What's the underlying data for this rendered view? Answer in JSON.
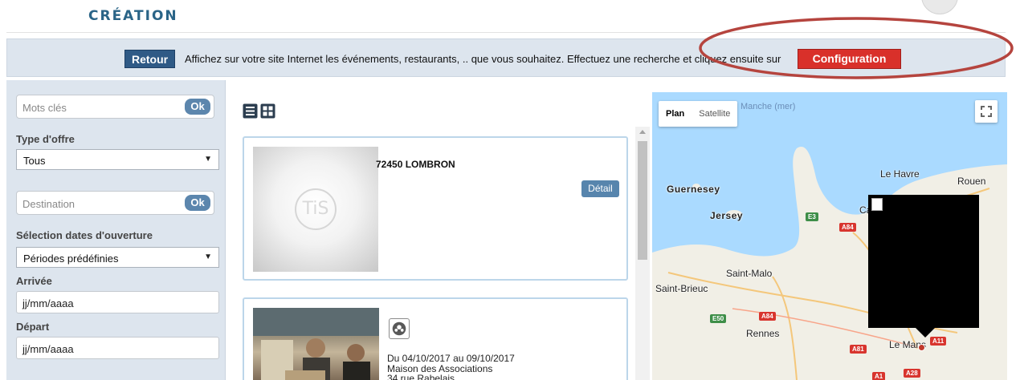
{
  "header": {
    "title": "CRÉATION"
  },
  "infobar": {
    "back_label": "Retour",
    "message": "Affichez sur votre site Internet les événements, restaurants, .. que vous souhaitez. Effectuez une recherche et cliquez ensuite sur",
    "config_label": "Configuration",
    "annotation_color": "#b5443e"
  },
  "sidebar": {
    "keywords": {
      "placeholder": "Mots clés",
      "button": "Ok"
    },
    "offer_type": {
      "label": "Type d'offre",
      "value": "Tous"
    },
    "destination": {
      "placeholder": "Destination",
      "button": "Ok"
    },
    "opening_dates": {
      "label": "Sélection dates d'ouverture",
      "value": "Périodes prédéfinies"
    },
    "arrival": {
      "label": "Arrivée",
      "value": "jj/mm/aaaa"
    },
    "departure": {
      "label": "Départ",
      "value": "jj/mm/aaaa"
    }
  },
  "view_toggle": {
    "list_icon": "list-view-icon",
    "grid_icon": "grid-view-icon"
  },
  "results": [
    {
      "placeholder_text": "TiS",
      "title": "72450 LOMBRON",
      "detail_label": "Détail"
    },
    {
      "dates": "Du 04/10/2017 au 09/10/2017",
      "venue": "Maison des Associations",
      "address": "34 rue Rabelais"
    }
  ],
  "map": {
    "tabs": [
      "Plan",
      "Satellite"
    ],
    "sea_label": "Manche (mer)",
    "places": [
      "Guernesey",
      "Jersey",
      "Le Havre",
      "Rouen",
      "Cae",
      "Saint-Malo",
      "Saint-Brieuc",
      "Rennes",
      "Le Mans"
    ],
    "roads": [
      "E3",
      "A84",
      "E50",
      "A84",
      "A81",
      "A11",
      "A1",
      "A28"
    ]
  },
  "colors": {
    "brand_blue": "#2a6487",
    "retour_bg": "#2f5a86",
    "config_bg": "#d9302a",
    "panel_bg": "#dde5ee",
    "ok_bg": "#5c86ad"
  }
}
